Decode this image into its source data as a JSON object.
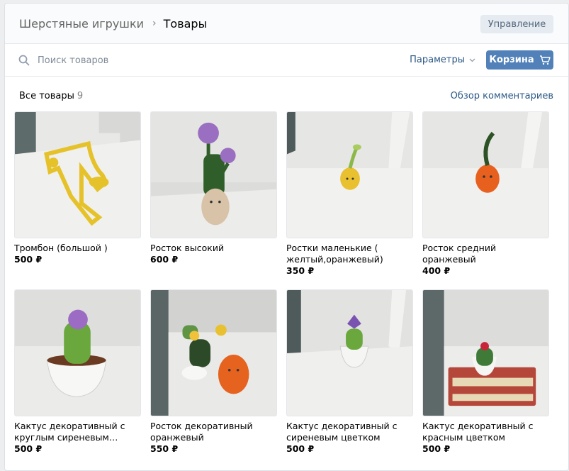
{
  "breadcrumb": {
    "group": "Шерстяные игрушки",
    "separator": "›",
    "current": "Товары"
  },
  "header": {
    "manage_label": "Управление"
  },
  "search": {
    "placeholder": "Поиск товаров"
  },
  "toolbar": {
    "params_label": "Параметры",
    "cart_label": "Корзина"
  },
  "subhead": {
    "all_label": "Все товары",
    "count": "9",
    "review_link": "Обзор комментариев"
  },
  "products": [
    {
      "title": "Тромбон (большой )",
      "price": "500 ₽"
    },
    {
      "title": "Росток высокий",
      "price": "600 ₽"
    },
    {
      "title": "Ростки маленькие ( желтый,оранжевый)",
      "price": "350 ₽"
    },
    {
      "title": "Росток средний оранжевый",
      "price": "400 ₽"
    },
    {
      "title": "Кактус декоративный с круглым сиреневым…",
      "price": "500 ₽"
    },
    {
      "title": "Росток декоративный оранжевый",
      "price": "550 ₽"
    },
    {
      "title": "Кактус декоративный с сиреневым цветком",
      "price": "500 ₽"
    },
    {
      "title": "Кактус декоративный с красным цветком",
      "price": "500 ₽"
    }
  ],
  "colors": {
    "accent": "#5181b8",
    "link": "#2a5885",
    "muted": "#818c99"
  }
}
